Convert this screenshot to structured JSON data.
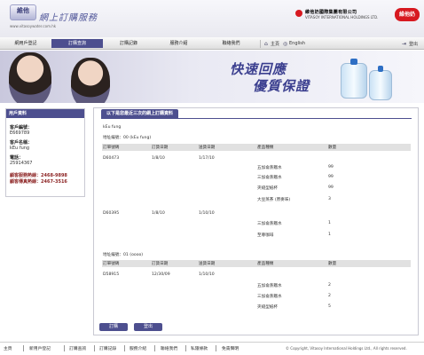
{
  "header": {
    "logo_text": "維他",
    "logo_sub": "www.vitasoywater.com.hk",
    "site_title": "網上訂購服務",
    "company_zh": "維他奶國際集團有限公司",
    "company_en": "VITASOY INTERNATIONAL HOLDINGS LTD.",
    "brand_logo": "維他奶"
  },
  "nav": {
    "items": [
      "網用戶登記",
      "訂購查詢",
      "訂購記錄",
      "服務介紹",
      "聯絡我們"
    ],
    "active": 1,
    "home": "主頁",
    "english": "English",
    "logout": "登出",
    "icons": {
      "home": "home-icon",
      "globe": "globe-icon",
      "exit": "exit-icon"
    }
  },
  "banner": {
    "line1": "快速回應",
    "line2": "優質保證"
  },
  "sidebar": {
    "title": "用戶資料",
    "fields": [
      {
        "label": "客戶編號：",
        "value": "E669789"
      },
      {
        "label": "客戶名稱：",
        "value": "kEu fung"
      },
      {
        "label": "電話：",
        "value": "25914367"
      }
    ],
    "hotline1": "顧客服務熱線：2468-9898",
    "hotline2": "顧客傳真熱線：2467-3516"
  },
  "main": {
    "tab_title": "以下是您最近三次的網上訂購資料",
    "customer": "kEu fung",
    "columns": [
      "訂單號碼",
      "訂貨日期",
      "送貨日期",
      "產品種類",
      "數量"
    ],
    "addresses": [
      {
        "label": "地址編號：00 (kEu fung)",
        "orders": [
          {
            "order_no": "D60473",
            "order_date": "1/8/10",
            "delivery_date": "1/17/10",
            "items": [
              [
                "五加侖蒸餾水",
                "99"
              ],
              [
                "三加侖蒸餾水",
                "99"
              ],
              [
                "夾縫型紙杯",
                "99"
              ],
              [
                "大豆蒸茶 (原麥味)",
                "3"
              ]
            ]
          },
          {
            "order_no": "D60395",
            "order_date": "1/8/10",
            "delivery_date": "1/10/10",
            "items": [
              [
                "三加侖蒸餾水",
                "1"
              ],
              [
                "至尊咖啡",
                "1"
              ]
            ]
          }
        ]
      },
      {
        "label": "地址編號：01 (oooo)",
        "orders": [
          {
            "order_no": "D58915",
            "order_date": "12/30/09",
            "delivery_date": "1/10/10",
            "items": [
              [
                "五加侖蒸餾水",
                "2"
              ],
              [
                "三加侖蒸餾水",
                "2"
              ],
              [
                "夾縫型紙杯",
                "5"
              ]
            ]
          }
        ]
      }
    ],
    "buttons": {
      "order": "訂購",
      "logout": "登出"
    }
  },
  "footer": {
    "links": [
      "主頁",
      "新用戶登記",
      "訂購查詢",
      "訂購記錄",
      "服務介紹",
      "聯絡我們",
      "私隱條款",
      "免責聲明"
    ],
    "copyright": "© Copyright, Vitasoy International Holdings Ltd., All rights reserved."
  },
  "colors": {
    "accent": "#4d4f8f",
    "brand": "#d71920"
  }
}
